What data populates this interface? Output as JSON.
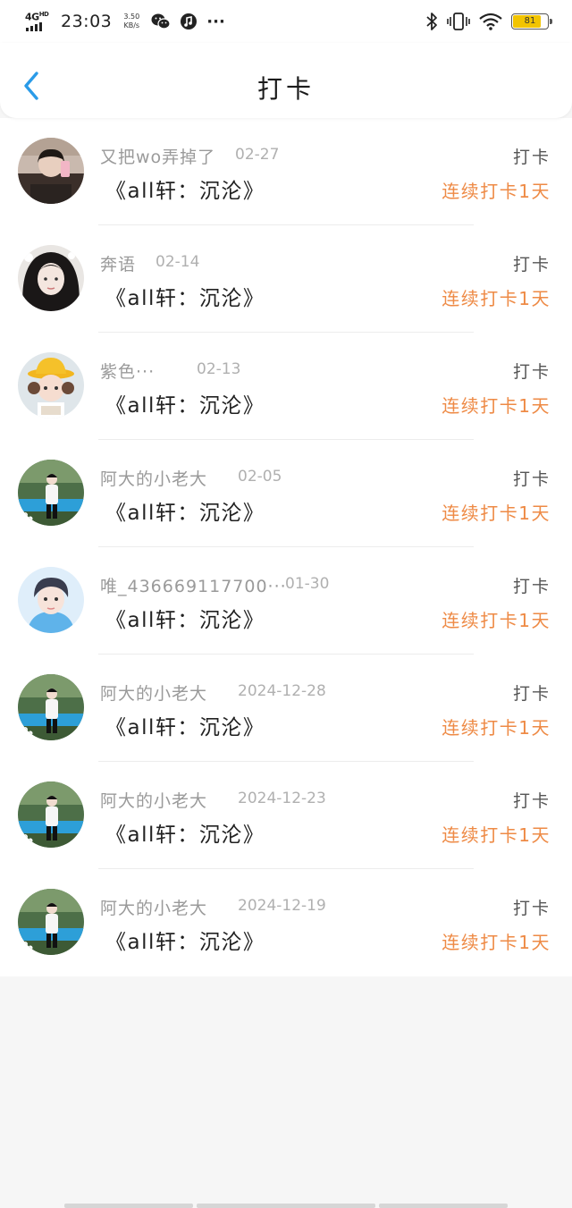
{
  "status_bar": {
    "network": "4G",
    "network_sup": "HD",
    "time": "23:03",
    "speed_value": "3.50",
    "speed_unit": "KB/s",
    "more": "···",
    "battery_level": "81",
    "battery_color": "#f2c400"
  },
  "header": {
    "title": "打卡",
    "back_icon": "chevron-left-icon",
    "back_color": "#2a9be8"
  },
  "items": [
    {
      "name": "又把wo弄掉了",
      "date": "02-27",
      "book": "《all轩：沉沦》",
      "action": "打卡",
      "streak": "连续打卡1天",
      "avatar": "avatar-selfie"
    },
    {
      "name": "奔语",
      "date": "02-14",
      "book": "《all轩：沉沦》",
      "action": "打卡",
      "streak": "连续打卡1天",
      "avatar": "avatar-girl"
    },
    {
      "name": "紫色···",
      "date": "02-13",
      "book": "《all轩：沉沦》",
      "action": "打卡",
      "streak": "连续打卡1天",
      "avatar": "avatar-yellow-hat"
    },
    {
      "name": "阿大的小老大",
      "date": "02-05",
      "book": "《all轩：沉沦》",
      "action": "打卡",
      "streak": "连续打卡1天",
      "avatar": "avatar-outdoor"
    },
    {
      "name": "唯_436669117700···",
      "date": "01-30",
      "book": "《all轩：沉沦》",
      "action": "打卡",
      "streak": "连续打卡1天",
      "avatar": "avatar-blue"
    },
    {
      "name": "阿大的小老大",
      "date": "2024-12-28",
      "book": "《all轩：沉沦》",
      "action": "打卡",
      "streak": "连续打卡1天",
      "avatar": "avatar-outdoor"
    },
    {
      "name": "阿大的小老大",
      "date": "2024-12-23",
      "book": "《all轩：沉沦》",
      "action": "打卡",
      "streak": "连续打卡1天",
      "avatar": "avatar-outdoor"
    },
    {
      "name": "阿大的小老大",
      "date": "2024-12-19",
      "book": "《all轩：沉沦》",
      "action": "打卡",
      "streak": "连续打卡1天",
      "avatar": "avatar-outdoor"
    }
  ],
  "colors": {
    "accent_orange": "#ee8a45",
    "name_gray": "#9a9a9a"
  }
}
